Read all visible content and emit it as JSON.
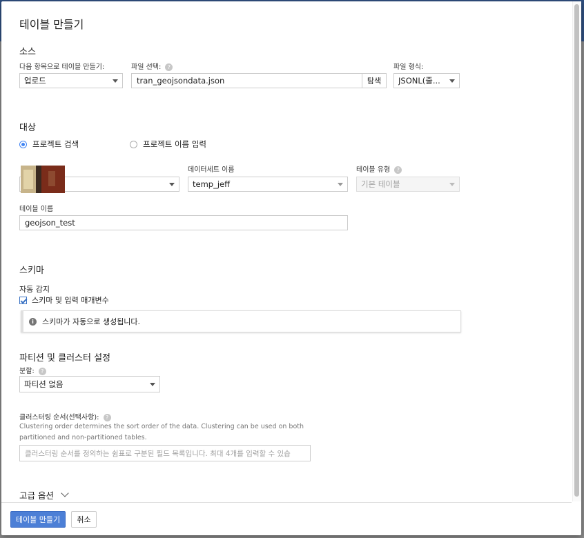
{
  "dialog": {
    "title": "테이블 만들기",
    "source": {
      "heading": "소스",
      "create_from_label": "다음 항목으로 테이블 만들기:",
      "create_from_value": "업로드",
      "file_label": "파일 선택:",
      "file_value": "tran_geojsondata.json",
      "browse_label": "탐색",
      "format_label": "파일 형식:",
      "format_value": "JSONL(줄..."
    },
    "destination": {
      "heading": "대상",
      "radio_search": "프로젝트 검색",
      "radio_enter": "프로젝트 이름 입력",
      "project_value": "",
      "dataset_label": "데이터세트 이름",
      "dataset_value": "temp_jeff",
      "table_type_label": "테이블 유형",
      "table_type_value": "기본 테이블",
      "table_name_label": "테이블 이름",
      "table_name_value": "geojson_test"
    },
    "schema": {
      "heading": "스키마",
      "auto_detect_label": "자동 감지",
      "checkbox_label": "스키마 및 입력 매개변수",
      "info_text": "스키마가 자동으로 생성됩니다."
    },
    "partition": {
      "heading": "파티션 및 클러스터 설정",
      "partition_label": "분할:",
      "partition_value": "파티션 없음",
      "clustering_label": "클러스터링 순서(선택사항):",
      "clustering_desc_1": "Clustering order determines the sort order of the data. Clustering can be used on both",
      "clustering_desc_2": "partitioned and non-partitioned tables.",
      "clustering_placeholder": "클러스터링 순서를 정의하는 쉼표로 구분된 필드 목록입니다. 최대 4개를 입력할 수 있습"
    },
    "advanced_label": "고급 옵션",
    "footer": {
      "create_button": "테이블 만들기",
      "cancel_button": "취소"
    }
  },
  "colors": {
    "primary": "#4c7fd6",
    "accent_radio": "#4285f4"
  },
  "icons": {
    "help": "help-circle-icon",
    "info": "info-icon",
    "dropdown": "caret-down-icon",
    "expand": "chevron-down-icon"
  }
}
